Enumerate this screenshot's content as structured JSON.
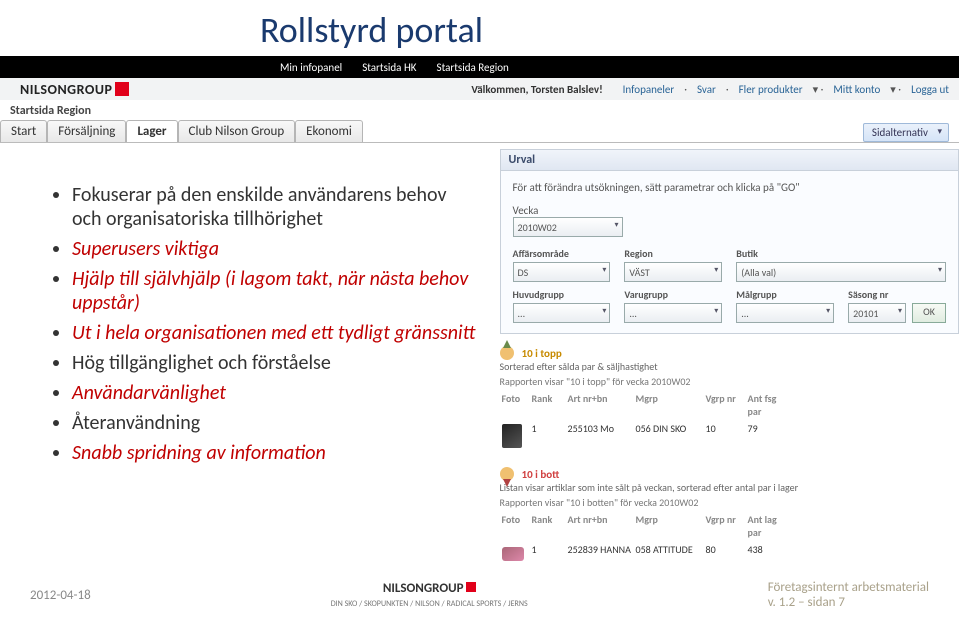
{
  "slide_title": "Rollstyrd portal",
  "topnav": {
    "items": [
      "Min infopanel",
      "Startsida HK",
      "Startsida Region"
    ]
  },
  "logo_text": "NILSONGROUP",
  "headerbar": {
    "welcome": "Välkommen, Torsten Balslev!",
    "links": [
      "Infopaneler",
      "Svar",
      "Fler produkter",
      "Mitt konto",
      "Logga ut"
    ]
  },
  "breadcrumb": "Startsida Region",
  "tabs": [
    "Start",
    "Försäljning",
    "Lager",
    "Club Nilson Group",
    "Ekonomi"
  ],
  "tab_active_index": 2,
  "sidealt_label": "Sidalternativ",
  "bullets": [
    {
      "text": "Fokuserar på den enskilde användarens behov  och organisatoriska tillhörighet",
      "class": ""
    },
    {
      "text": "Superusers viktiga",
      "class": "em1"
    },
    {
      "text": "Hjälp till självhjälp (i lagom takt, när nästa behov uppstår)",
      "class": "em1"
    },
    {
      "text": "Ut i hela organisationen med ett tydligt gränssnitt",
      "class": "em1"
    },
    {
      "text": "Hög tillgänglighet och förståelse",
      "class": ""
    },
    {
      "text": "Användarvänlighet",
      "class": "em2"
    },
    {
      "text": "Återanvändning",
      "class": ""
    },
    {
      "text": "Snabb spridning av information",
      "class": "em2"
    }
  ],
  "panel": {
    "title": "Urval",
    "hint": "För att förändra utsökningen, sätt parametrar och klicka på \"GO\"",
    "fields": {
      "vecka_label": "Vecka",
      "vecka_val": "2010W02",
      "aff_label": "Affärsområde",
      "aff_val": "DS",
      "region_label": "Region",
      "region_val": "VÄST",
      "butik_label": "Butik",
      "butik_val": "(Alla val)",
      "hg_label": "Huvudgrupp",
      "hg_val": "...",
      "vg_label": "Varugrupp",
      "vg_val": "...",
      "mg_label": "Målgrupp",
      "mg_val": "...",
      "sasong_label": "Säsong nr",
      "sasong_val": "20101",
      "ok": "OK"
    }
  },
  "report_top": {
    "title": "10 i topp",
    "sub": "Sorterad efter sålda par & säljhastighet",
    "hdr": "Rapporten visar \"10 i topp\" för vecka 2010W02",
    "cols": [
      "Foto",
      "Rank",
      "Art nr+bn",
      "Mgrp",
      "Vgrp nr",
      "Ant fsg par"
    ],
    "row": [
      "",
      "1",
      "255103 Mo",
      "056 DIN SKO",
      "10",
      "79"
    ]
  },
  "report_bot": {
    "title": "10 i bott",
    "sub": "Listan visar artiklar som inte sålt på veckan, sorterad efter antal par i lager",
    "hdr": "Rapporten visar \"10 i botten\" för vecka 2010W02",
    "cols": [
      "Foto",
      "Rank",
      "Art nr+bn",
      "Mgrp",
      "Vgrp nr",
      "Ant lag par"
    ],
    "row": [
      "",
      "1",
      "252839 HANNA",
      "058 ATTITUDE",
      "80",
      "438"
    ]
  },
  "footer": {
    "date": "2012-04-18",
    "logo": "NILSONGROUP",
    "logo_sub": "DIN SKO / SKOPUNKTEN / NILSON / RADICAL SPORTS / JERNS",
    "note1": "Företagsinternt arbetsmaterial",
    "note2": "v. 1.2 – sidan  7"
  }
}
